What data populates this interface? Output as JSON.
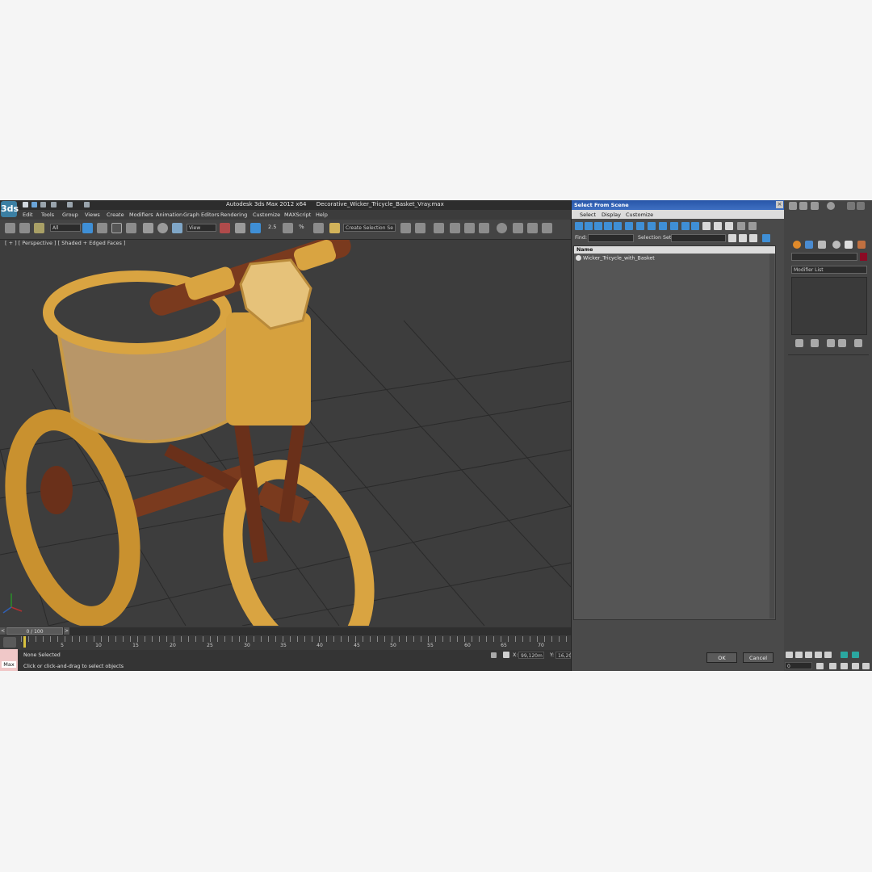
{
  "app": {
    "logo": "3ds",
    "product_title": "Autodesk 3ds Max  2012 x64",
    "file_title": "Decorative_Wicker_Tricycle_Basket_Vray.max"
  },
  "menu": {
    "items": [
      "Edit",
      "Tools",
      "Group",
      "Views",
      "Create",
      "Modifiers",
      "Animation",
      "Graph Editors",
      "Rendering",
      "Customize",
      "MAXScript",
      "Help"
    ]
  },
  "toolbar": {
    "selection_filter": "All",
    "ref_coord": "View",
    "snap_label": "2.5",
    "percent_snap_label": "%",
    "named_selection": "Create Selection Se"
  },
  "viewport": {
    "label": "[ + ] [ Perspective ] [ Shaded + Edged Faces ]"
  },
  "timeline": {
    "position": "0 / 100",
    "ticks": [
      "5",
      "10",
      "15",
      "20",
      "25",
      "30",
      "35",
      "40",
      "45",
      "50",
      "55",
      "60",
      "65",
      "70"
    ]
  },
  "status": {
    "selection": "None Selected",
    "prompt": "Click or click-and-drag to select objects",
    "x_label": "X:",
    "x_value": "99,120m",
    "y_label": "Y:",
    "y_value": "16,20",
    "max_label": "Max"
  },
  "dialog": {
    "title": "Select From Scene",
    "menu": [
      "Select",
      "Display",
      "Customize"
    ],
    "find_label": "Find:",
    "selection_set_label": "Selection Set:",
    "column_header": "Name",
    "objects": [
      "Wicker_Tricycle_with_Basket"
    ],
    "ok_label": "OK",
    "cancel_label": "Cancel"
  },
  "command_panel": {
    "modifier_list": "Modifier List",
    "object_color": "#8a0a24",
    "frame_value": "0"
  },
  "colors": {
    "viewport_bg": "#3d3d3d",
    "dialog_title": "#2f5fb3",
    "wicker": "#d9a441",
    "wood": "#7a3a1e"
  }
}
